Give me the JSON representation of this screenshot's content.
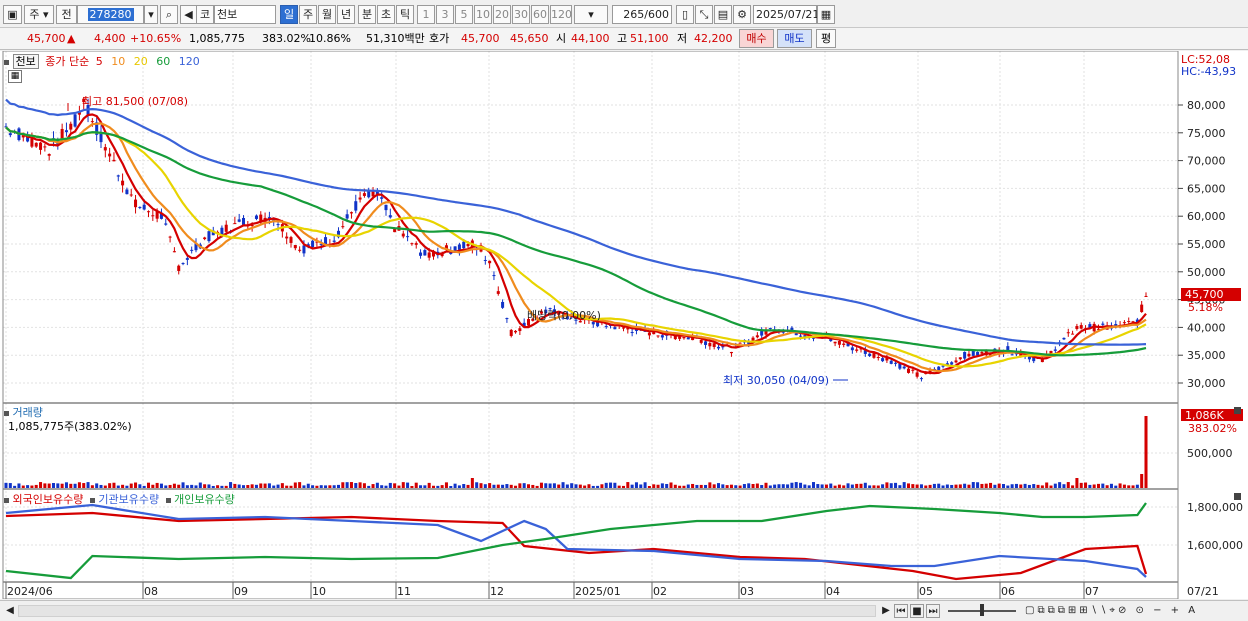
{
  "toolbar": {
    "market": "주",
    "period_sel": "전",
    "code": "278280",
    "code_prefix": "코",
    "name": "천보",
    "periods": [
      "일",
      "주",
      "월",
      "년",
      "분",
      "초",
      "틱"
    ],
    "minutes": [
      "1",
      "3",
      "5",
      "10",
      "20",
      "30",
      "60",
      "120"
    ],
    "count": "265",
    "count_total": "/600",
    "date": "2025/07/21"
  },
  "quote": {
    "price": "45,700",
    "arrow": "▲",
    "change": "4,400",
    "change_pct": "+10.65%",
    "volume": "1,085,775",
    "vol_ratio": "383.02%",
    "turnover": "10.86%",
    "amount": "51,310백만",
    "ask_label": "호가",
    "ask": "45,700",
    "bid": "45,650",
    "open_label": "시",
    "open": "44,100",
    "high_label": "고",
    "high": "51,100",
    "low_label": "저",
    "low": "42,200",
    "buy_btn": "매수",
    "sell_btn": "매도",
    "eval_btn": "평"
  },
  "price_panel": {
    "name": "천보",
    "ma_title": "종가 단순",
    "ma_periods": [
      "5",
      "10",
      "20",
      "60",
      "120"
    ],
    "ma_colors": [
      "#d40000",
      "#f08c1e",
      "#e8d400",
      "#169c3a",
      "#3a62d8"
    ],
    "lc": "LC:52,08",
    "hc": "HC:-43,93",
    "high_note": "최고 81,500 (07/08)",
    "low_note": "최저 30,050 (04/09)",
    "div_note": "배당락(0,00%)",
    "cur_price": "45,700",
    "cur_pct": "5.18%",
    "y_labels": [
      "80,000",
      "75,000",
      "70,000",
      "65,000",
      "60,000",
      "55,000",
      "50,000",
      "45,000",
      "40,000",
      "35,000",
      "30,000"
    ]
  },
  "volume_panel": {
    "title": "거래량",
    "value": "1,085,775주(383.02%)",
    "cur": "1,086K",
    "cur_pct": "383.02%",
    "y_label": "500,000"
  },
  "holding_panel": {
    "series": [
      "외국인보유수량",
      "기관보유수량",
      "개인보유수량"
    ],
    "series_colors": [
      "#d40000",
      "#3a62d8",
      "#169c3a"
    ],
    "y_labels": [
      "1,800,000",
      "1,600,000"
    ]
  },
  "x_labels": [
    "2024/06",
    "08",
    "09",
    "10",
    "11",
    "12",
    "2025/01",
    "02",
    "03",
    "04",
    "05",
    "06",
    "07",
    "07/21"
  ]
}
